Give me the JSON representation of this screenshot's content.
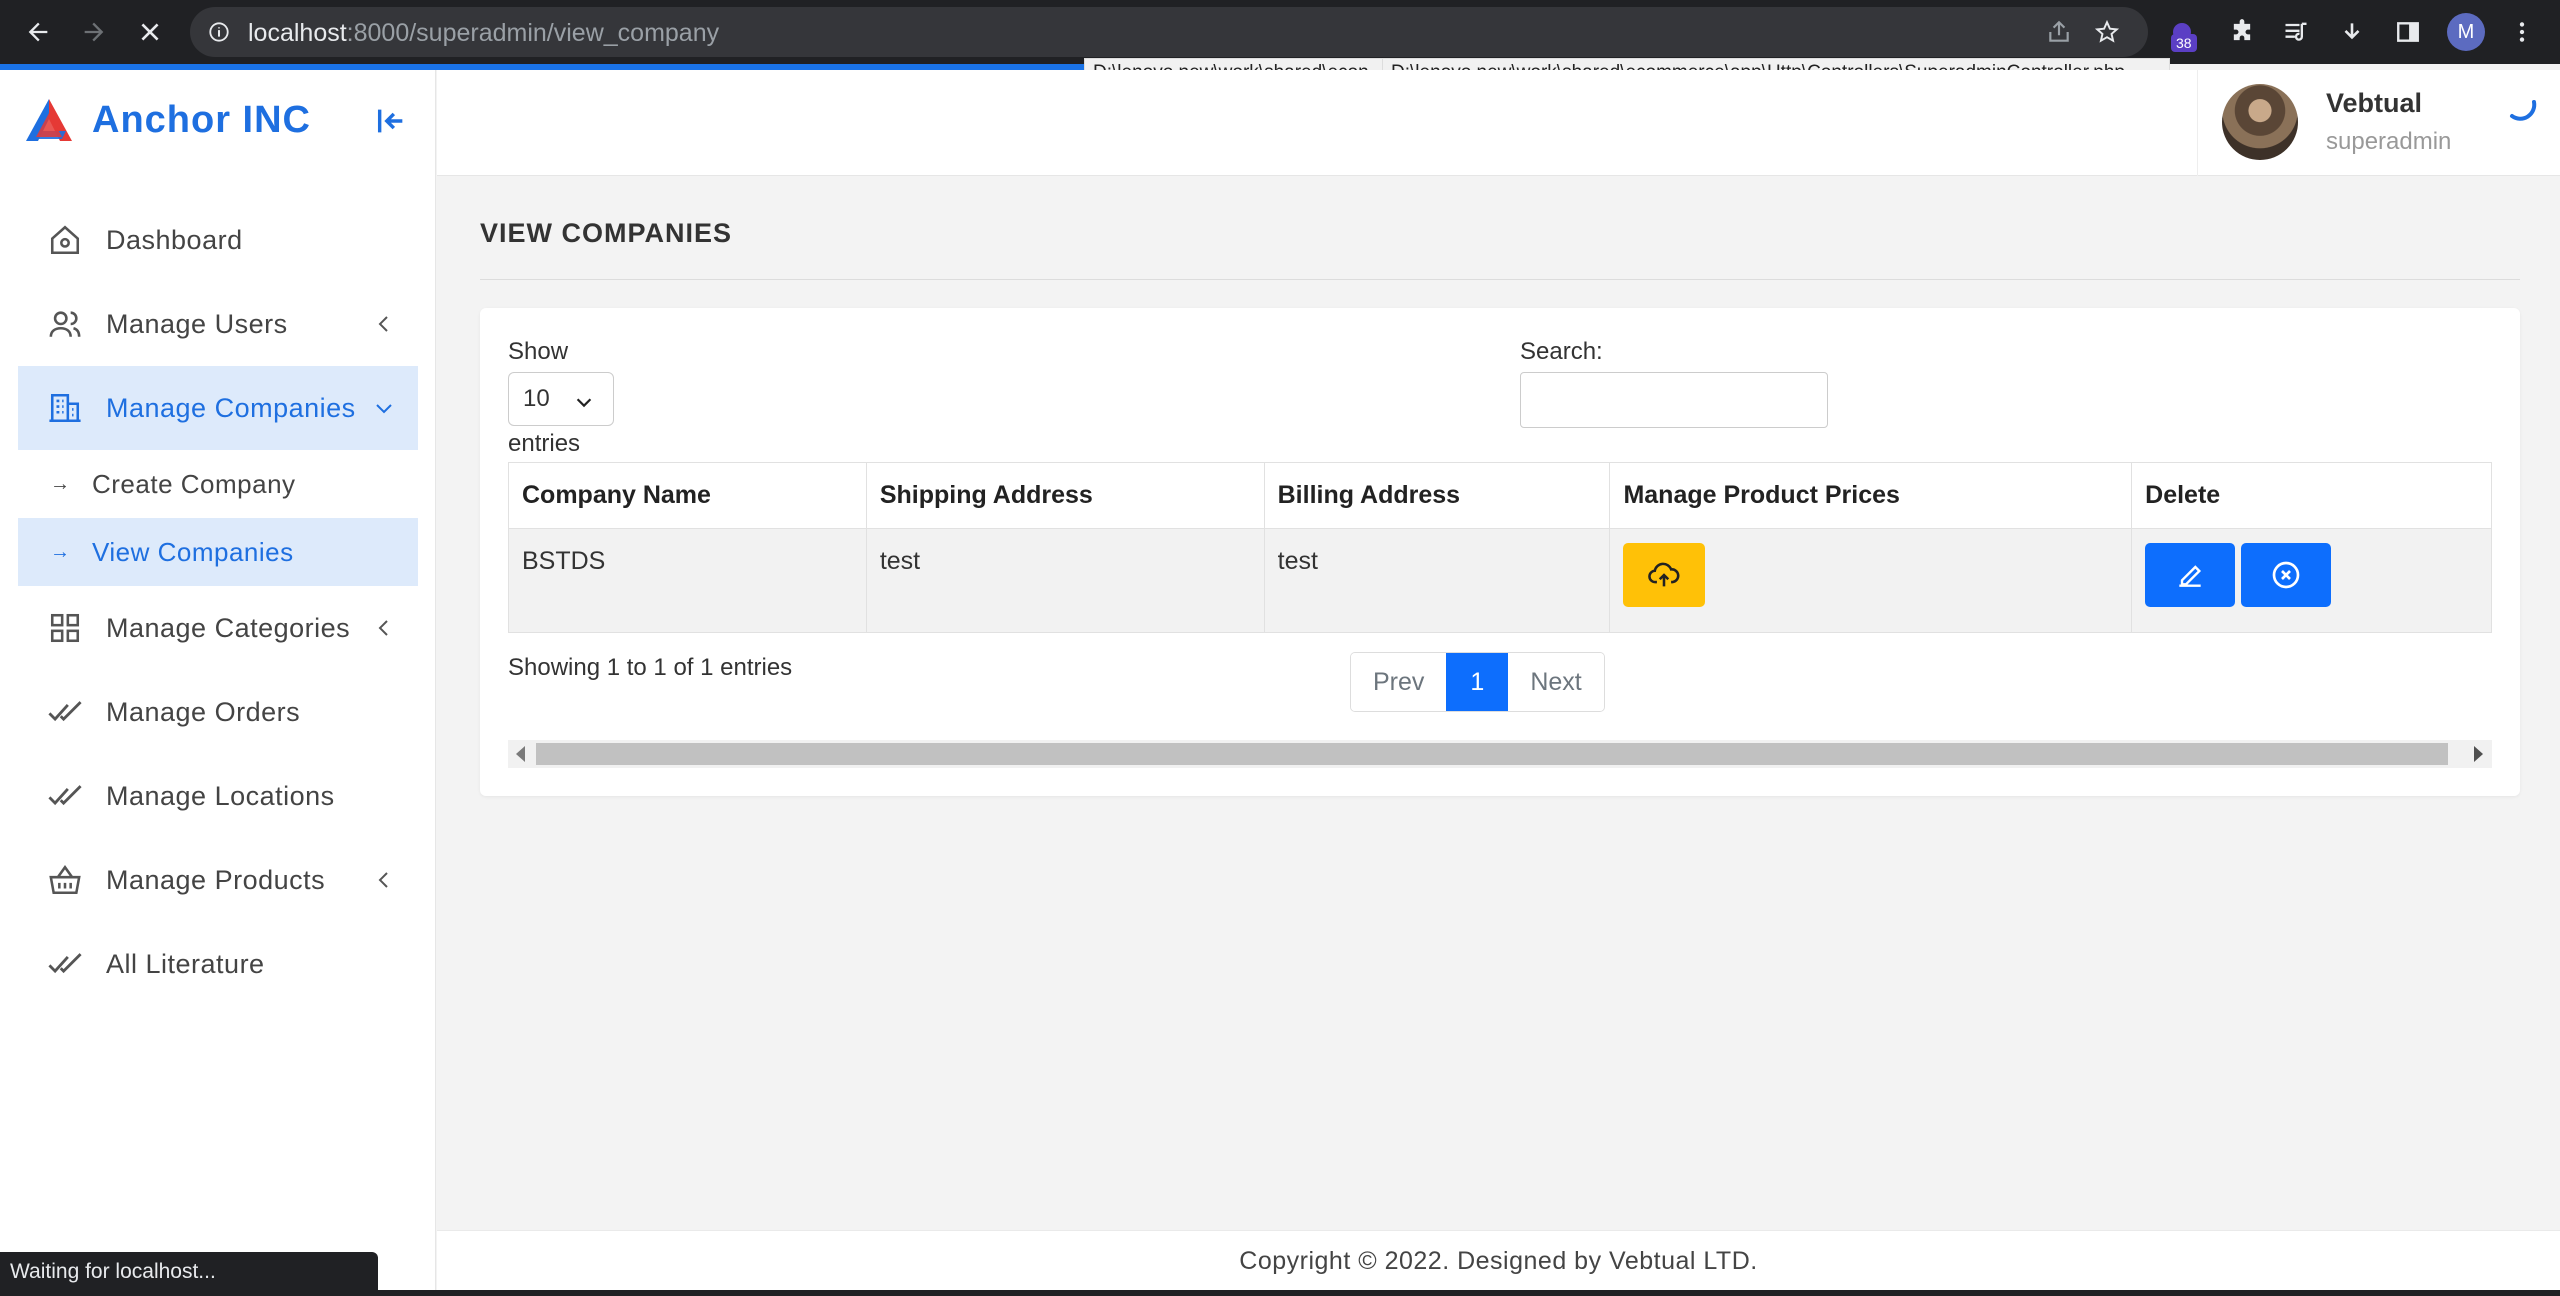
{
  "browser": {
    "url_host": "localhost",
    "url_path": ":8000/superadmin/view_company",
    "extension_badge": "38",
    "profile_initial": "M",
    "status_text": "Waiting for localhost...",
    "tooltip_1": "D:\\lenovo new\\work\\shared\\econ",
    "tooltip_2": "D:\\lenovo new\\work\\shared\\ecommerce\\app\\Http\\Controllers\\SuperadminController.php"
  },
  "brand": {
    "name": "Anchor INC",
    "accent": "#1e6fe0"
  },
  "sidebar": {
    "items": [
      {
        "label": "Dashboard",
        "icon": "home-icon"
      },
      {
        "label": "Manage Users",
        "icon": "users-icon"
      },
      {
        "label": "Manage Companies",
        "icon": "building-icon"
      },
      {
        "label": "Manage Categories",
        "icon": "grid-icon"
      },
      {
        "label": "Manage Orders",
        "icon": "double-check-icon"
      },
      {
        "label": "Manage Locations",
        "icon": "double-check-icon"
      },
      {
        "label": "Manage Products",
        "icon": "basket-icon"
      },
      {
        "label": "All Literature",
        "icon": "double-check-icon"
      }
    ],
    "sub_items": [
      {
        "label": "Create Company"
      },
      {
        "label": "View Companies"
      }
    ]
  },
  "user": {
    "name": "Vebtual",
    "role": "superadmin"
  },
  "page": {
    "title": "VIEW COMPANIES"
  },
  "table_controls": {
    "show_label": "Show",
    "page_size": "10",
    "entries_label": "entries",
    "search_label": "Search:",
    "search_value": ""
  },
  "table": {
    "headers": [
      "Company Name",
      "Shipping Address",
      "Billing Address",
      "Manage Product Prices",
      "Delete"
    ],
    "rows": [
      {
        "company_name": "BSTDS",
        "shipping_address": "test",
        "billing_address": "test"
      }
    ]
  },
  "pagination": {
    "info": "Showing 1 to 1 of 1 entries",
    "prev": "Prev",
    "current": "1",
    "next": "Next"
  },
  "footer": {
    "text": "Copyright © 2022. Designed by Vebtual LTD."
  },
  "colors": {
    "primary": "#0d6efd",
    "warning": "#ffc107",
    "active_bg": "#ddeafb"
  }
}
